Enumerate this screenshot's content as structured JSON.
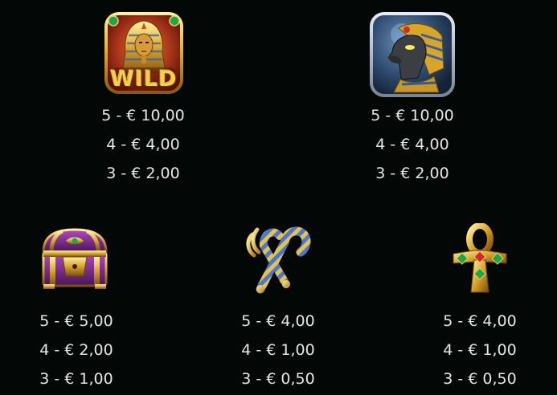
{
  "symbols": {
    "wild": {
      "icon": "pharaoh-sphinx-wild-icon",
      "label": "WILD",
      "pays": [
        "5 - € 10,00",
        "4 - € 4,00",
        "3 - € 2,00"
      ]
    },
    "anubis": {
      "icon": "jackal-god-icon",
      "pays": [
        "5 - € 10,00",
        "4 - € 4,00",
        "3 - € 2,00"
      ]
    },
    "chest": {
      "icon": "treasure-chest-icon",
      "pays": [
        "5 - € 5,00",
        "4 - € 2,00",
        "3 - € 1,00"
      ]
    },
    "crook": {
      "icon": "crook-and-flail-icon",
      "pays": [
        "5 - € 4,00",
        "4 - € 1,00",
        "3 - € 0,50"
      ]
    },
    "ankh": {
      "icon": "ankh-icon",
      "pays": [
        "5 - € 4,00",
        "4 - € 1,00",
        "3 - € 0,50"
      ]
    }
  },
  "colors": {
    "background": "#030806",
    "text": "#e6e6e6",
    "gold": "#e0a82a",
    "wild_red": "#9c2a12",
    "anubis_blue": "#3a5f86",
    "chest_purple": "#7a2a8a",
    "crook_blue": "#4a78d0",
    "gem_green": "#1fa64a",
    "gem_red": "#d22a2a"
  }
}
